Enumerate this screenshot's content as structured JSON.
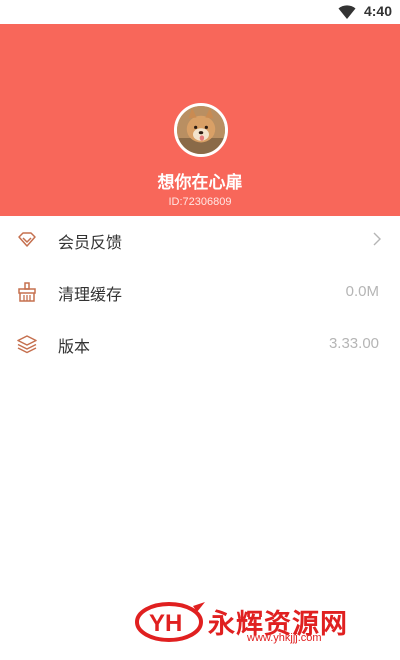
{
  "status_bar": {
    "time": "4:40",
    "wifi_icon": "wifi-icon"
  },
  "profile": {
    "username": "想你在心扉",
    "user_id": "ID:72306809",
    "avatar": "avatar-dog-photo"
  },
  "menu": {
    "items": [
      {
        "label": "会员反馈",
        "icon": "diamond-icon",
        "value": "",
        "trailing": "chevron-right-icon"
      },
      {
        "label": "清理缓存",
        "icon": "broom-icon",
        "value": "0.0M"
      },
      {
        "label": "版本",
        "icon": "layers-icon",
        "value": "3.33.00"
      }
    ]
  },
  "watermark": {
    "brand": "永辉资源网",
    "url": "www.yhkjjj.com",
    "logo_text": "YH"
  },
  "colors": {
    "header_bg": "#f8675a",
    "icon_color": "#c5704f",
    "value_text": "#b5b5b5",
    "watermark": "#e02020"
  }
}
